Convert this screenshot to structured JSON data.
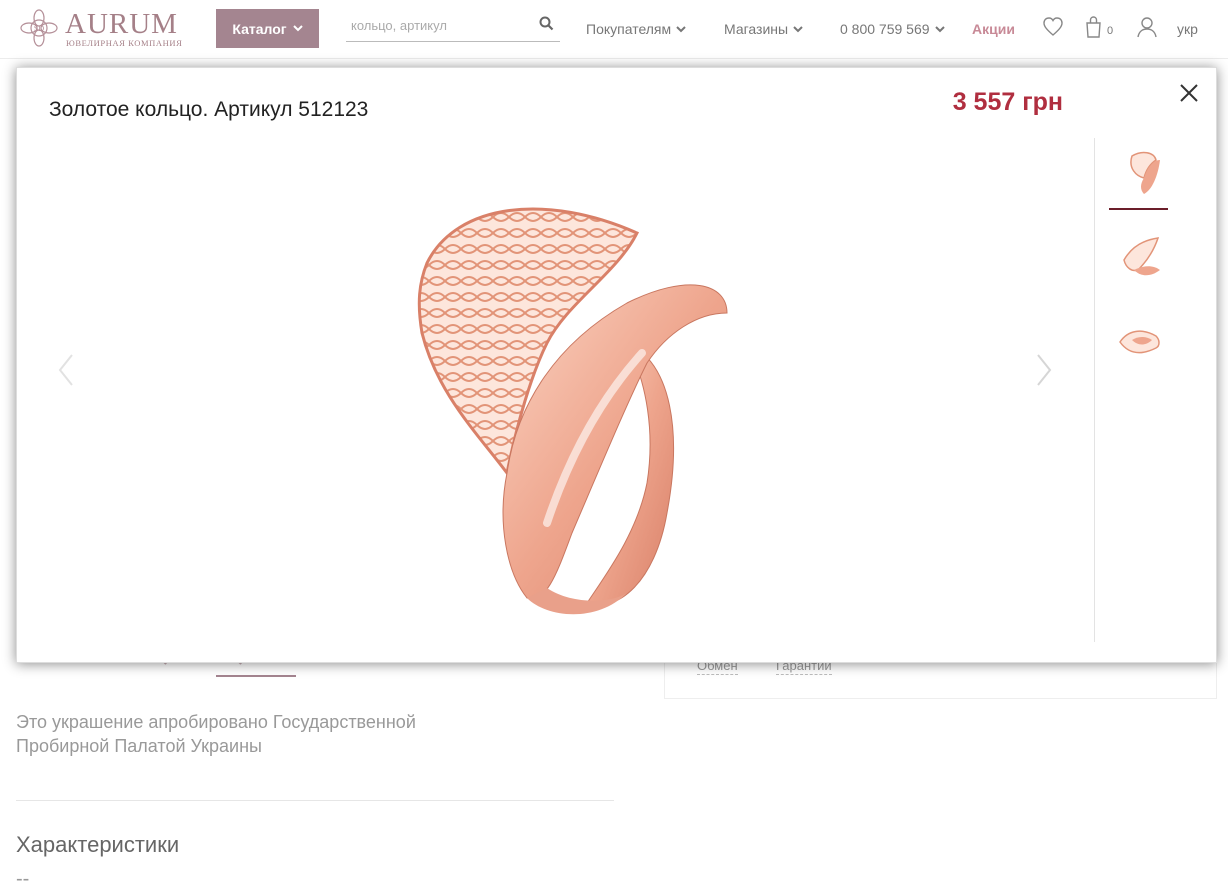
{
  "header": {
    "logo_name": "AURUM",
    "logo_sub": "ЮВЕЛИРНАЯ КОМПАНИЯ",
    "catalog_label": "Каталог",
    "search_placeholder": "кольцо, артикул",
    "nav": {
      "buyers": "Покупателям",
      "stores": "Магазины",
      "phone": "0 800 759 569",
      "promo": "Акции"
    },
    "cart_count": "0",
    "lang": "укр"
  },
  "modal": {
    "title": "Золотое кольцо. Артикул 512123",
    "price": "3 557 грн",
    "thumbs": [
      "ring-front-view",
      "ring-side-view",
      "ring-top-view"
    ],
    "active_thumb": 0
  },
  "page": {
    "assay_text": "Это украшение апробировано Государственной Пробирной Палатой Украины",
    "characteristics_heading": "Характеристики",
    "characteristics_first": "--",
    "links": {
      "exchange": "Обмен",
      "warranty": "Гарантии"
    }
  },
  "colors": {
    "brand": "#a48590",
    "price": "#b02e3f",
    "promo": "#c88a97",
    "gold": "#f0b5a0"
  }
}
